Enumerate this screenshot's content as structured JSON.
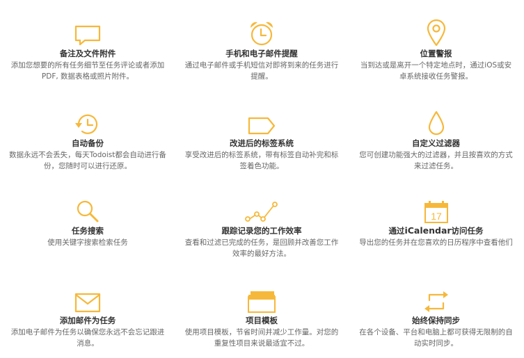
{
  "accent_color": "#f6b83a",
  "features": [
    {
      "icon": "speech-bubble-icon",
      "title": "备注及文件附件",
      "desc": "添加您想要的所有任务细节至任务评论或者添加PDF, 数据表格或照片附件。"
    },
    {
      "icon": "alarm-clock-icon",
      "title": "手机和电子邮件提醒",
      "desc": "通过电子邮件或手机短信对即将到来的任务进行提醒。"
    },
    {
      "icon": "location-pin-icon",
      "title": "位置警报",
      "desc": "当到达或是离开一个特定地点时，通过iOS或安卓系统接收任务警报。"
    },
    {
      "icon": "backup-clock-icon",
      "title": "自动备份",
      "desc": "数据永远不会丢失，每天Todoist都会自动进行备份，您随时可以进行还原。"
    },
    {
      "icon": "label-tag-icon",
      "title": "改进后的标签系统",
      "desc": "享受改进后的标签系统，带有标签自动补完和标签着色功能。"
    },
    {
      "icon": "drop-filter-icon",
      "title": "自定义过滤器",
      "desc": "您可创建功能强大的过滤器，并且按喜欢的方式来过滤任务。"
    },
    {
      "icon": "magnifier-icon",
      "title": "任务搜索",
      "desc": "使用关键字搜索检索任务"
    },
    {
      "icon": "productivity-graph-icon",
      "title": "跟踪记录您的工作效率",
      "desc": "查看和过滤已完成的任务，是回顾并改善您工作效率的最好方法。"
    },
    {
      "icon": "calendar-icon",
      "calendar_day": "17",
      "title_parts": {
        "before": "通过",
        "bold": "iCalendar",
        "after": "访问任务"
      },
      "desc": "导出您的任务并在您喜欢的日历程序中查看他们"
    },
    {
      "icon": "envelope-icon",
      "title": "添加邮件为任务",
      "desc": "添加电子邮件为任务以确保您永远不会忘记跟进消息。"
    },
    {
      "icon": "template-stack-icon",
      "title": "项目模板",
      "desc": "使用项目模板，节省时间并减少工作量。对您的重复性项目来说最适宜不过。"
    },
    {
      "icon": "sync-arrows-icon",
      "title": "始终保持同步",
      "desc": "在各个设备、平台和电脑上都可获得无限制的自动实时同步。"
    }
  ]
}
